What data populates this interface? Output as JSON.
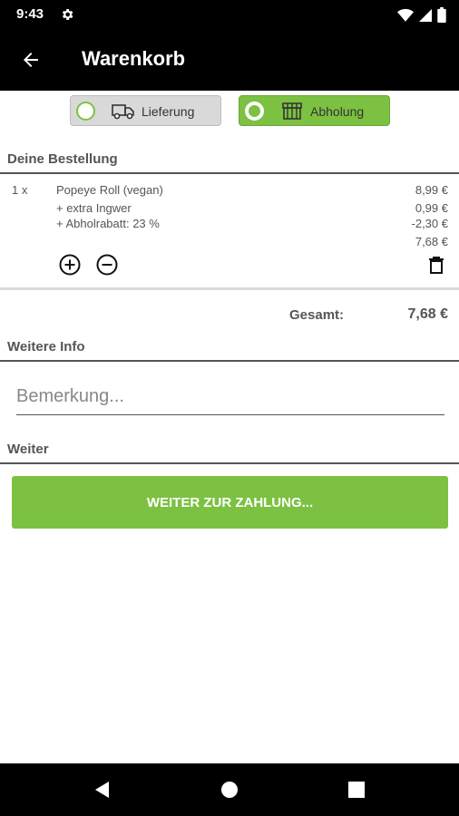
{
  "status_bar": {
    "time": "9:43"
  },
  "app_bar": {
    "title": "Warenkorb"
  },
  "fulfillment": {
    "options": [
      {
        "label": "Lieferung",
        "selected": false
      },
      {
        "label": "Abholung",
        "selected": true
      }
    ]
  },
  "order": {
    "section_title": "Deine Bestellung",
    "items": [
      {
        "qty": "1 x",
        "name": "Popeye Roll (vegan)",
        "price": "8,99 €",
        "extras": [
          {
            "label": "+ extra Ingwer",
            "price": "0,99 €"
          },
          {
            "label": "+ Abholrabatt: 23 %",
            "price": "-2,30 €"
          }
        ],
        "subtotal": "7,68 €"
      }
    ],
    "total_label": "Gesamt:",
    "total_value": "7,68 €"
  },
  "info": {
    "section_title": "Weitere Info",
    "remark_placeholder": "Bemerkung..."
  },
  "next": {
    "section_title": "Weiter",
    "button_label": "WEITER ZUR ZAHLUNG..."
  },
  "colors": {
    "accent": "#7cc142",
    "bar": "#000000",
    "text": "#555555"
  }
}
